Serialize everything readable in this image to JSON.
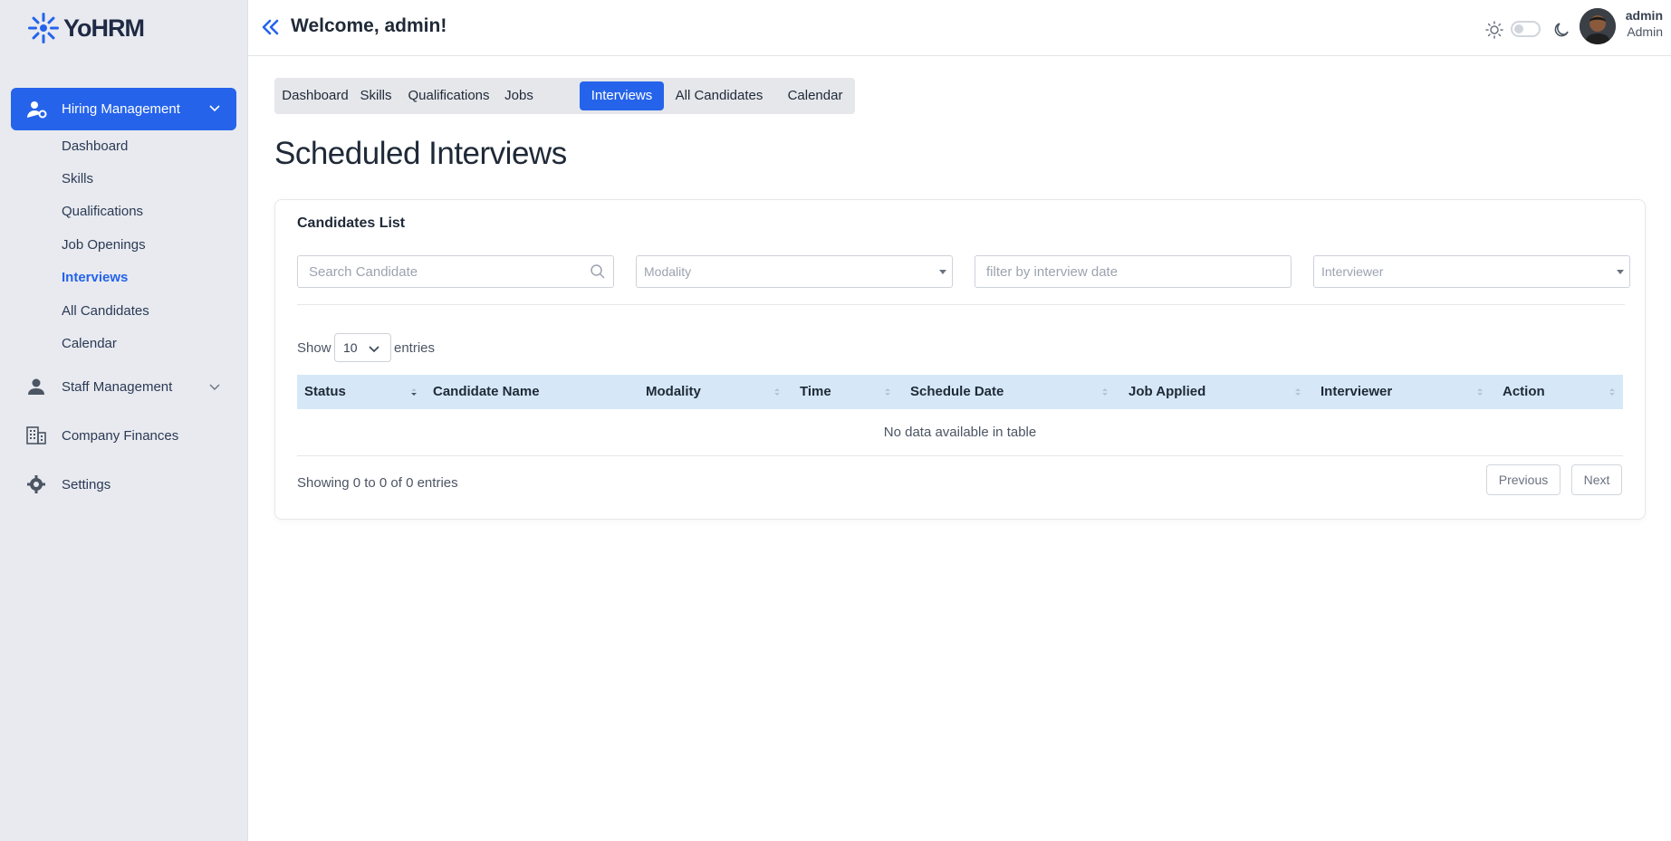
{
  "brand": {
    "name": "YoHRM"
  },
  "sidebar": {
    "hiring": {
      "label": "Hiring Management"
    },
    "sub_items": [
      {
        "label": "Dashboard"
      },
      {
        "label": "Skills"
      },
      {
        "label": "Qualifications"
      },
      {
        "label": "Job Openings"
      },
      {
        "label": "Interviews"
      },
      {
        "label": "All Candidates"
      },
      {
        "label": "Calendar"
      }
    ],
    "items": [
      {
        "label": "Staff Management",
        "icon": "user-icon"
      },
      {
        "label": "Company Finances",
        "icon": "building-icon"
      },
      {
        "label": "Settings",
        "icon": "gear-icon"
      }
    ]
  },
  "topbar": {
    "welcome": "Welcome, admin!",
    "user_name": "admin",
    "user_role": "Admin"
  },
  "tabs": [
    {
      "label": "Dashboard"
    },
    {
      "label": "Skills"
    },
    {
      "label": "Qualifications"
    },
    {
      "label": "Jobs"
    },
    {
      "label": "Interviews",
      "active": true
    },
    {
      "label": "All Candidates"
    },
    {
      "label": "Calendar"
    }
  ],
  "page": {
    "title": "Scheduled Interviews"
  },
  "card": {
    "title": "Candidates List",
    "filters": {
      "search_placeholder": "Search Candidate",
      "modality": "Modality",
      "date_placeholder": "filter by interview date",
      "interviewer": "Interviewer"
    },
    "show_label": "Show",
    "entries_value": "10",
    "entries_label": "entries",
    "columns": [
      "Status",
      "Candidate Name",
      "Modality",
      "Time",
      "Schedule Date",
      "Job Applied",
      "Interviewer",
      "Action"
    ],
    "empty_text": "No data available in table",
    "info": "Showing 0 to 0 of 0 entries",
    "prev": "Previous",
    "next": "Next"
  },
  "colors": {
    "accent": "#2563eb",
    "sidebar_bg": "#e8eaef",
    "header_row": "#d6e8f7"
  }
}
